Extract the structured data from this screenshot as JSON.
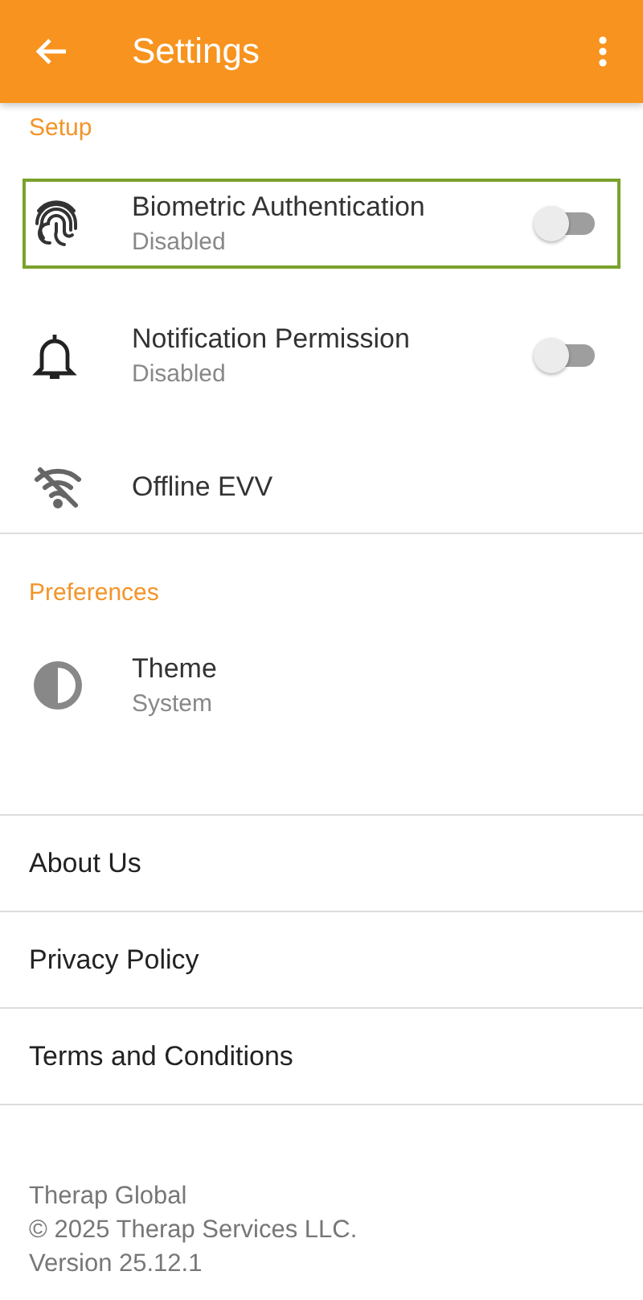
{
  "app_bar": {
    "title": "Settings"
  },
  "sections": [
    {
      "heading": "Setup",
      "items": [
        {
          "kind": "toggle",
          "title": "Biometric Authentication",
          "subtitle": "Disabled",
          "on": false,
          "focused": true
        },
        {
          "kind": "toggle",
          "title": "Notification Permission",
          "subtitle": "Disabled",
          "on": false,
          "focused": false
        },
        {
          "kind": "link",
          "title": "Offline EVV",
          "focused": false
        }
      ]
    },
    {
      "heading": "Preferences",
      "items": [
        {
          "kind": "value",
          "title": "Theme",
          "subtitle": "System",
          "focused": false
        }
      ]
    }
  ],
  "links": [
    "About Us",
    "Privacy Policy",
    "Terms and Conditions"
  ],
  "footer": [
    "Therap Global",
    "© 2025 Therap Services LLC.",
    "Version 25.12.1"
  ]
}
